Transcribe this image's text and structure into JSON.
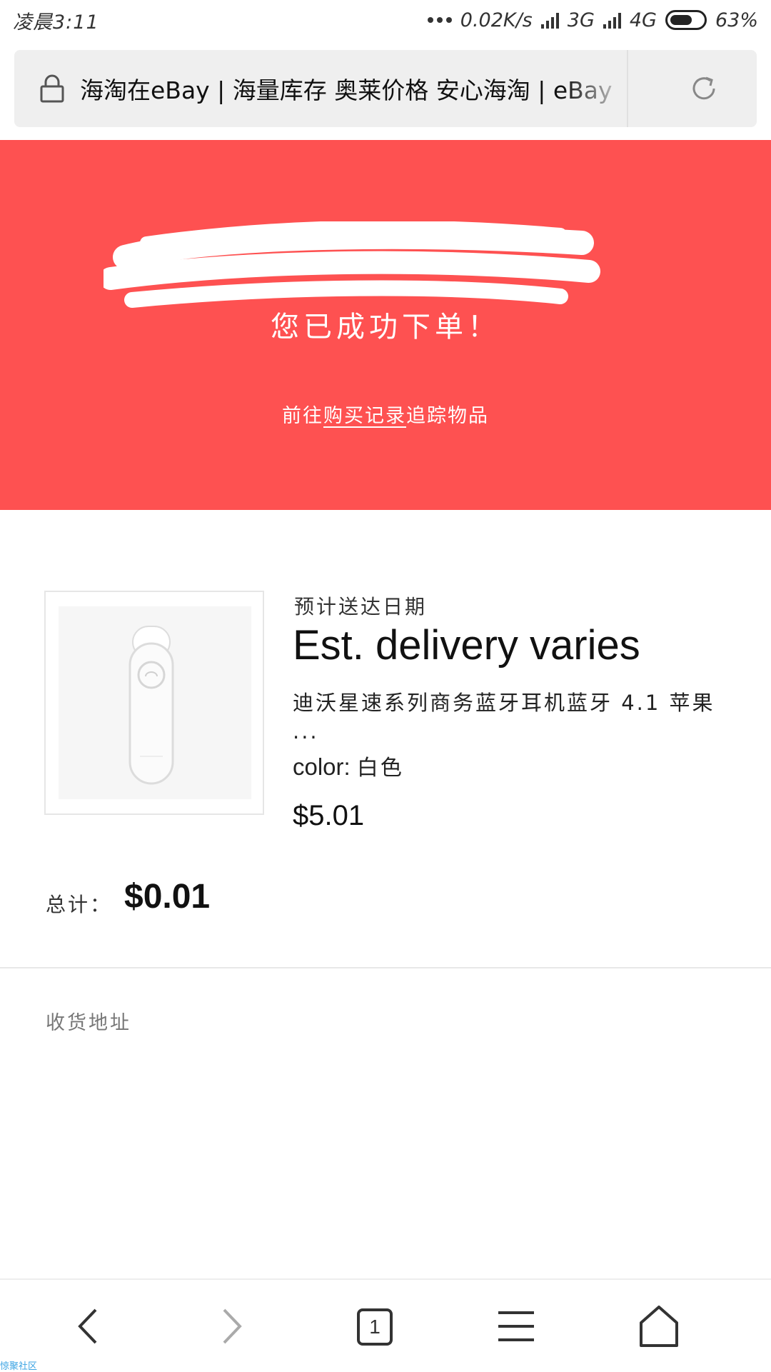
{
  "status_bar": {
    "time": "凌晨3:11",
    "network_speed": "0.02K/s",
    "network_1": "3G",
    "network_2": "4G",
    "battery": "63%"
  },
  "browser": {
    "url_title": "海淘在eBay | 海量库存 奥莱价格 安心海淘 | eBay",
    "tab_count": "1"
  },
  "hero": {
    "title": "您已成功下单！",
    "link_prefix": "前往",
    "link_text": "购买记录",
    "link_suffix": "追踪物品",
    "bg_color": "#fe5151"
  },
  "order": {
    "delivery_label": "预计送达日期",
    "delivery_value": "Est. delivery varies",
    "product_name": "迪沃星速系列商务蓝牙耳机蓝牙 4.1 苹果 ...",
    "color_label": "color:",
    "color_value": "白色",
    "price": "$5.01",
    "total_label": "总计：",
    "total_value": "$0.01"
  },
  "shipping": {
    "title": "收货地址"
  },
  "icons": {
    "lock": "lock-icon",
    "reload": "reload-icon",
    "back": "back-arrow-icon",
    "forward": "forward-arrow-icon",
    "tabs": "tabs-icon",
    "menu": "hamburger-menu-icon",
    "home": "home-icon"
  },
  "watermark": "惊聚社区"
}
